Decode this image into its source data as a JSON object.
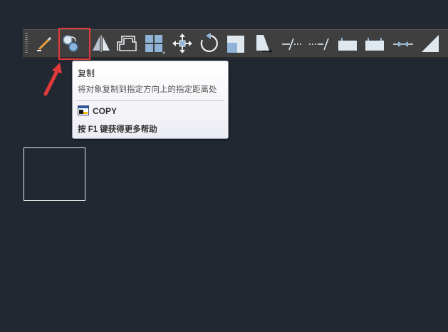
{
  "toolbar": {
    "tools": [
      {
        "id": "erase",
        "icon": "erase-icon"
      },
      {
        "id": "copy",
        "icon": "copy-icon",
        "highlighted": true
      },
      {
        "id": "mirror",
        "icon": "mirror-icon"
      },
      {
        "id": "offset",
        "icon": "offset-icon"
      },
      {
        "id": "array",
        "icon": "array-icon"
      },
      {
        "id": "move",
        "icon": "move-icon"
      },
      {
        "id": "rotate",
        "icon": "rotate-icon"
      },
      {
        "id": "scale",
        "icon": "scale-icon"
      },
      {
        "id": "stretch",
        "icon": "stretch-icon"
      },
      {
        "id": "trim",
        "icon": "trim-icon"
      },
      {
        "id": "extend",
        "icon": "extend-icon"
      },
      {
        "id": "break-at-point",
        "icon": "break-at-point-icon"
      },
      {
        "id": "break",
        "icon": "break-icon"
      },
      {
        "id": "join",
        "icon": "join-icon"
      },
      {
        "id": "chamfer",
        "icon": "chamfer-icon"
      }
    ]
  },
  "tooltip": {
    "title": "复制",
    "description": "将对象复制到指定方向上的指定距离处",
    "command": "COPY",
    "help": "按 F1 键获得更多帮助"
  },
  "colors": {
    "canvas_bg": "#222831",
    "toolbar_bg": "#3f3f3f",
    "highlight": "#e23a3a",
    "drawn_rect": "#e8e8e8"
  }
}
